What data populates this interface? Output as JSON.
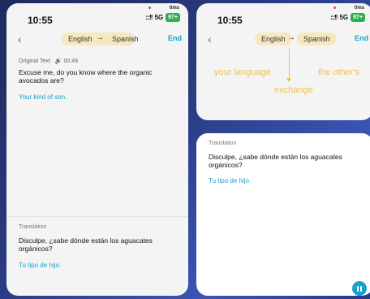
{
  "status": {
    "time": "10:55",
    "signal": ":::!!",
    "network": "5G",
    "battery": "97+",
    "speed": "0ms"
  },
  "nav": {
    "back_icon": "chevron-left-icon",
    "source_lang": "English",
    "arrow": "→",
    "target_lang": "Spanish",
    "end_label": "End"
  },
  "original": {
    "label": "Original Text",
    "duration": "00:49",
    "text": "Excuse me, do you know where the organic avocados are?",
    "back_translation": "Your kind of son."
  },
  "translation": {
    "label": "Translation",
    "text": "Disculpe, ¿sabe dónde están los aguacates orgánicos?",
    "back_translation": "Tu tipo de hijo."
  },
  "exchange": {
    "your_language": "your language",
    "others_language": "the other's",
    "exchange_label": "exchange"
  },
  "colors": {
    "accent": "#1aa0c9",
    "pill": "#f6e8bf",
    "exchange": "#f0c24a",
    "battery": "#2bb24c"
  }
}
